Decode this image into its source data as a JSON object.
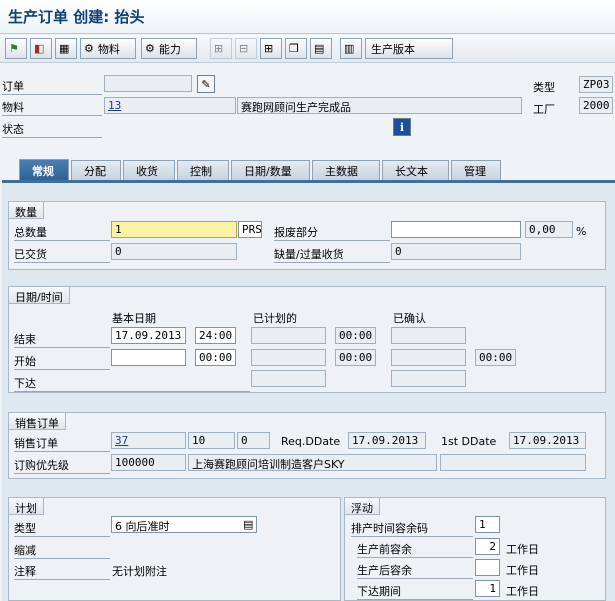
{
  "window": {
    "title": "生产订单 创建: 抬头"
  },
  "toolbar": {
    "buttons": [
      {
        "icon": "flag-icon",
        "glyph": "⚑",
        "label": ""
      },
      {
        "icon": "status-icon",
        "glyph": "◧",
        "label": ""
      },
      {
        "icon": "table-icon",
        "glyph": "▦",
        "label": ""
      },
      {
        "icon": "material-icon",
        "glyph": "⚙",
        "label": "物料"
      },
      {
        "icon": "capacity-icon",
        "glyph": "⚙",
        "label": "能力"
      },
      {
        "icon": "hierarchy-icon-1",
        "glyph": "⊞",
        "label": ""
      },
      {
        "icon": "hierarchy-icon-2",
        "glyph": "⊟",
        "label": ""
      },
      {
        "icon": "hierarchy-icon-3",
        "glyph": "⊞",
        "label": ""
      },
      {
        "icon": "copy-icon",
        "glyph": "❐",
        "label": ""
      },
      {
        "icon": "document-icon",
        "glyph": "▤",
        "label": ""
      },
      {
        "icon": "version-icon",
        "glyph": "▥",
        "label": "生产版本"
      }
    ]
  },
  "header": {
    "order_label": "订单",
    "order_value": "",
    "material_label": "物料",
    "material_value": "13",
    "material_desc": "赛跑网顾问生产完成品",
    "status_label": "状态",
    "type_label": "类型",
    "type_value": "ZP03",
    "plant_label": "工厂",
    "plant_value": "2000"
  },
  "tabs": [
    "常规",
    "分配",
    "收货",
    "控制",
    "日期/数量",
    "主数据",
    "长文本",
    "管理"
  ],
  "qty": {
    "title": "数量",
    "total_label": "总数量",
    "total_value": "1",
    "unit": "PRS",
    "scrap_label": "报废部分",
    "scrap_value": "",
    "scrap_pct": "0,00",
    "pct_sign": "%",
    "delivered_label": "已交货",
    "delivered_value": "0",
    "short_label": "缺量/过量收货",
    "short_value": "0"
  },
  "dates": {
    "title": "日期/时间",
    "col_basic": "基本日期",
    "col_planned": "已计划的",
    "col_confirmed": "已确认",
    "end_label": "结束",
    "end_date": "17.09.2013",
    "end_time": "24:00",
    "planned_end_time": "00:00",
    "start_label": "开始",
    "start_date": "",
    "start_time": "00:00",
    "planned_start_time": "00:00",
    "confirmed_start_time": "00:00",
    "release_label": "下达"
  },
  "sales": {
    "title": "销售订单",
    "order_label": "销售订单",
    "order_no": "37",
    "item": "10",
    "sched": "0",
    "req_label": "Req.DDate",
    "req_date": "17.09.2013",
    "first_label": "1st DDate",
    "first_date": "17.09.2013",
    "prio_label": "订购优先级",
    "prio_value": "100000",
    "customer": "上海赛跑顾问培训制造客户SKY"
  },
  "plan": {
    "title": "计划",
    "type_label": "类型",
    "type_value": "6 向后准时",
    "reduce_label": "缩减",
    "note_label": "注释",
    "note_value": "无计划附注"
  },
  "float": {
    "title": "浮动",
    "sched_margin_label": "排产时间容余码",
    "sched_margin_value": "1",
    "before_label": "生产前容余",
    "before_value": "2",
    "after_label": "生产后容余",
    "after_value": "",
    "release_label": "下达期间",
    "release_value": "1",
    "unit": "工作日"
  }
}
